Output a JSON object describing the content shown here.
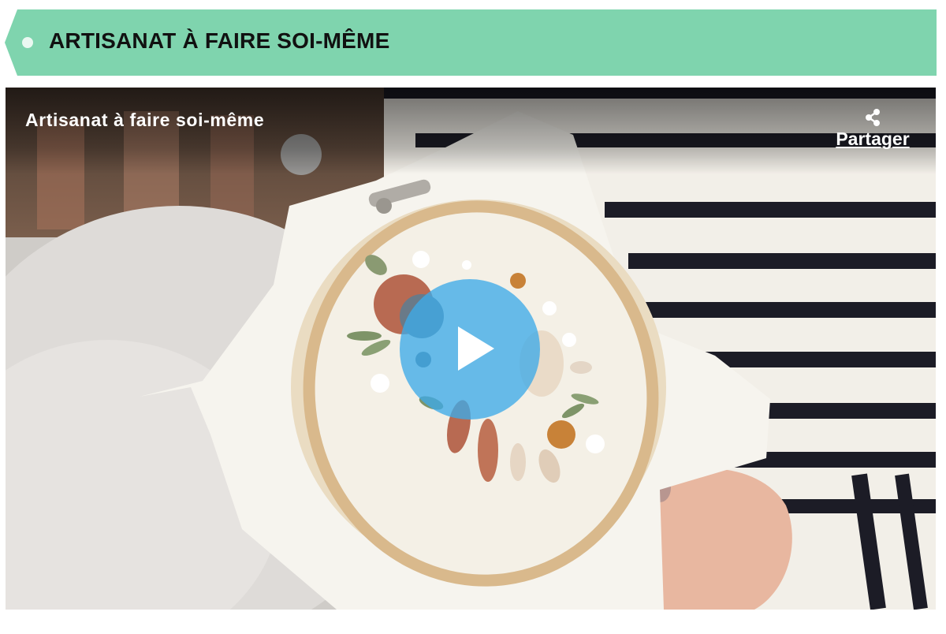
{
  "banner": {
    "title": "ARTISANAT À FAIRE SOI-MÊME",
    "color": "#7fd4ae"
  },
  "video": {
    "title": "Artisanat à faire soi-même",
    "share_label": "Partager",
    "play_button_color": "#3daae8",
    "icons": [
      "share-icon",
      "play-icon"
    ]
  }
}
